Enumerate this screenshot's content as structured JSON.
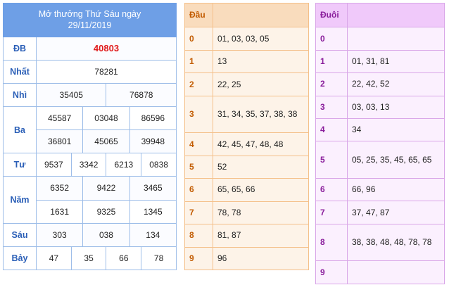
{
  "results": {
    "title_line1": "Mở thưởng Thứ Sáu ngày",
    "title_line2": "29/11/2019",
    "prizes": {
      "db": {
        "label": "ĐB",
        "values": [
          "40803"
        ]
      },
      "nhat": {
        "label": "Nhất",
        "values": [
          "78281"
        ]
      },
      "nhi": {
        "label": "Nhì",
        "values": [
          "35405",
          "76878"
        ]
      },
      "ba": {
        "label": "Ba",
        "values": [
          "45587",
          "03048",
          "86596",
          "36801",
          "45065",
          "39948"
        ]
      },
      "tu": {
        "label": "Tư",
        "values": [
          "9537",
          "3342",
          "6213",
          "0838"
        ]
      },
      "nam": {
        "label": "Năm",
        "values": [
          "6352",
          "9422",
          "3465",
          "1631",
          "9325",
          "1345"
        ]
      },
      "sau": {
        "label": "Sáu",
        "values": [
          "303",
          "038",
          "134"
        ]
      },
      "bay": {
        "label": "Bảy",
        "values": [
          "47",
          "35",
          "66",
          "78"
        ]
      }
    }
  },
  "head_table": {
    "header": "Đầu",
    "rows": [
      {
        "num": "0",
        "values": "01, 03, 03, 05"
      },
      {
        "num": "1",
        "values": "13"
      },
      {
        "num": "2",
        "values": "22, 25"
      },
      {
        "num": "3",
        "values": "31, 34, 35, 37, 38, 38"
      },
      {
        "num": "4",
        "values": "42, 45, 47, 48, 48"
      },
      {
        "num": "5",
        "values": "52"
      },
      {
        "num": "6",
        "values": "65, 65, 66"
      },
      {
        "num": "7",
        "values": "78, 78"
      },
      {
        "num": "8",
        "values": "81, 87"
      },
      {
        "num": "9",
        "values": "96"
      }
    ]
  },
  "tail_table": {
    "header": "Đuôi",
    "rows": [
      {
        "num": "0",
        "values": ""
      },
      {
        "num": "1",
        "values": "01, 31, 81"
      },
      {
        "num": "2",
        "values": "22, 42, 52"
      },
      {
        "num": "3",
        "values": "03, 03, 13"
      },
      {
        "num": "4",
        "values": "34"
      },
      {
        "num": "5",
        "values": "05, 25, 35, 45, 65, 65"
      },
      {
        "num": "6",
        "values": "66, 96"
      },
      {
        "num": "7",
        "values": "37, 47, 87"
      },
      {
        "num": "8",
        "values": "38, 38, 48, 48, 78, 78"
      },
      {
        "num": "9",
        "values": ""
      }
    ]
  },
  "colors": {
    "results_header": "#6e9fe6",
    "label_blue": "#2b5fb7",
    "special_red": "#e01b1b",
    "head_header": "#f9dcbd",
    "tail_header": "#f0c9fa"
  }
}
